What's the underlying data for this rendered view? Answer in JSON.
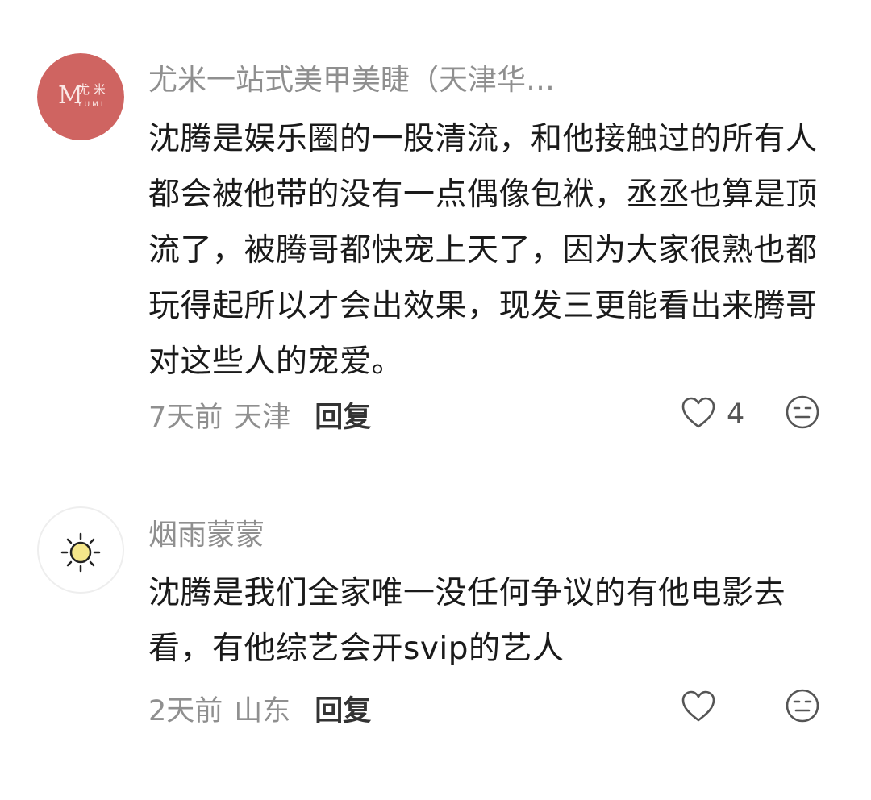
{
  "comments": [
    {
      "username": "尤米一站式美甲美睫（天津华…",
      "avatar_logo": {
        "mark": "M",
        "cn": "尤 米",
        "en": "YUMI",
        "color": "#cf6461"
      },
      "text": "沈腾是娱乐圈的一股清流，和他接触过的所有人都会被他带的没有一点偶像包袱，丞丞也算是顶流了，被腾哥都快宠上天了，因为大家很熟也都玩得起所以才会出效果，现发三更能看出来腾哥对这些人的宠爱。",
      "time": "7天前",
      "region": "天津",
      "reply_label": "回复",
      "like_count": "4",
      "like_icon": "heart-outline-icon",
      "dislike_icon": "meh-face-icon"
    },
    {
      "username": "烟雨蒙蒙",
      "avatar_icon": "sun-icon",
      "text": "沈腾是我们全家唯一没任何争议的有他电影去看，有他综艺会开svip的艺人",
      "time": "2天前",
      "region": "山东",
      "reply_label": "回复",
      "like_count": "",
      "like_icon": "heart-outline-icon",
      "dislike_icon": "meh-face-icon"
    }
  ]
}
